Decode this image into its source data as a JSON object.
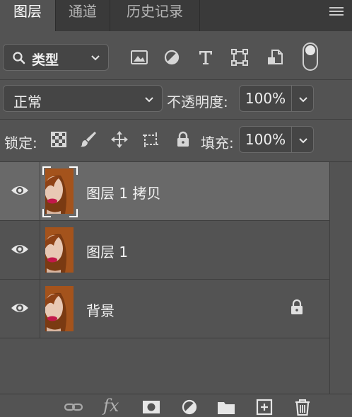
{
  "tabs": [
    {
      "label": "图层",
      "active": true
    },
    {
      "label": "通道",
      "active": false
    },
    {
      "label": "历史记录",
      "active": false
    }
  ],
  "filter": {
    "kind_label": "类型",
    "icons": [
      "image-filter-icon",
      "adjustment-filter-icon",
      "type-filter-icon",
      "shape-filter-icon",
      "smart-object-filter-icon"
    ],
    "toggle_on": true
  },
  "blend": {
    "mode": "正常",
    "opacity_label": "不透明度:",
    "opacity_value": "100%"
  },
  "lock": {
    "label": "锁定:",
    "icons": [
      "lock-transparent-pixels-icon",
      "lock-image-pixels-icon",
      "lock-position-icon",
      "lock-artboard-icon",
      "lock-all-icon"
    ],
    "fill_label": "填充:",
    "fill_value": "100%"
  },
  "layers": [
    {
      "name": "图层 1 拷贝",
      "visible": true,
      "selected": true,
      "locked": false
    },
    {
      "name": "图层 1",
      "visible": true,
      "selected": false,
      "locked": false
    },
    {
      "name": "背景",
      "visible": true,
      "selected": false,
      "locked": true
    }
  ],
  "bottom_actions": [
    "link-layers-icon",
    "layer-style-fx-icon",
    "add-mask-icon",
    "new-adjustment-layer-icon",
    "new-group-folder-icon",
    "new-layer-icon",
    "delete-trash-icon"
  ],
  "fx_label": "fx",
  "colors": {
    "panel_bg": "#535353",
    "tabbar_bg": "#3a3a3a",
    "selected_row": "#696969",
    "field_bg": "#454545"
  }
}
